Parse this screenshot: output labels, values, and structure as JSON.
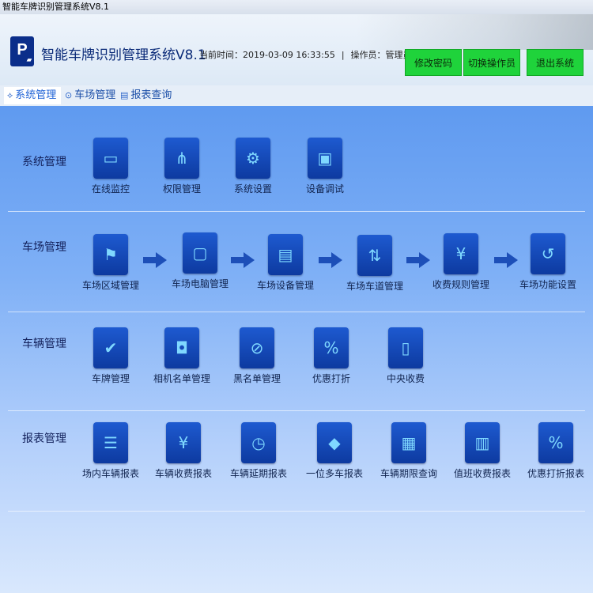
{
  "window_title": "智能车牌识别管理系统V8.1",
  "header": {
    "logo_text": "P",
    "app_title": "智能车牌识别管理系统V8.1",
    "time_label": "当前时间：2019-03-09 16:33:55",
    "sep": "|",
    "operator_label": "操作员：管理员",
    "buttons": {
      "change_password": "修改密码",
      "switch_operator": "切换操作员",
      "exit": "退出系统"
    },
    "button_color": "#1fd33b"
  },
  "menu": {
    "items": [
      {
        "label": "系统管理",
        "icon": "share-icon"
      },
      {
        "label": "车场管理",
        "icon": "parking-icon"
      },
      {
        "label": "报表查询",
        "icon": "report-icon"
      }
    ]
  },
  "sections": {
    "system": {
      "title": "系统管理",
      "items": [
        "在线监控",
        "权限管理",
        "系统设置",
        "设备调试"
      ]
    },
    "parking": {
      "title": "车场管理",
      "items": [
        "车场区域管理",
        "车场电脑管理",
        "车场设备管理",
        "车场车道管理",
        "收费规则管理",
        "车场功能设置"
      ]
    },
    "vehicle": {
      "title": "车辆管理",
      "items": [
        "车牌管理",
        "相机名单管理",
        "黑名单管理",
        "优惠打折",
        "中央收费"
      ]
    },
    "report": {
      "title": "报表管理",
      "items": [
        "场内车辆报表",
        "车辆收费报表",
        "车辆延期报表",
        "一位多车报表",
        "车辆期限查询",
        "值班收费报表",
        "优惠打折报表"
      ]
    }
  },
  "colors": {
    "accent": "#0d3aa0",
    "icon_glyph": "#7fd8ff"
  }
}
